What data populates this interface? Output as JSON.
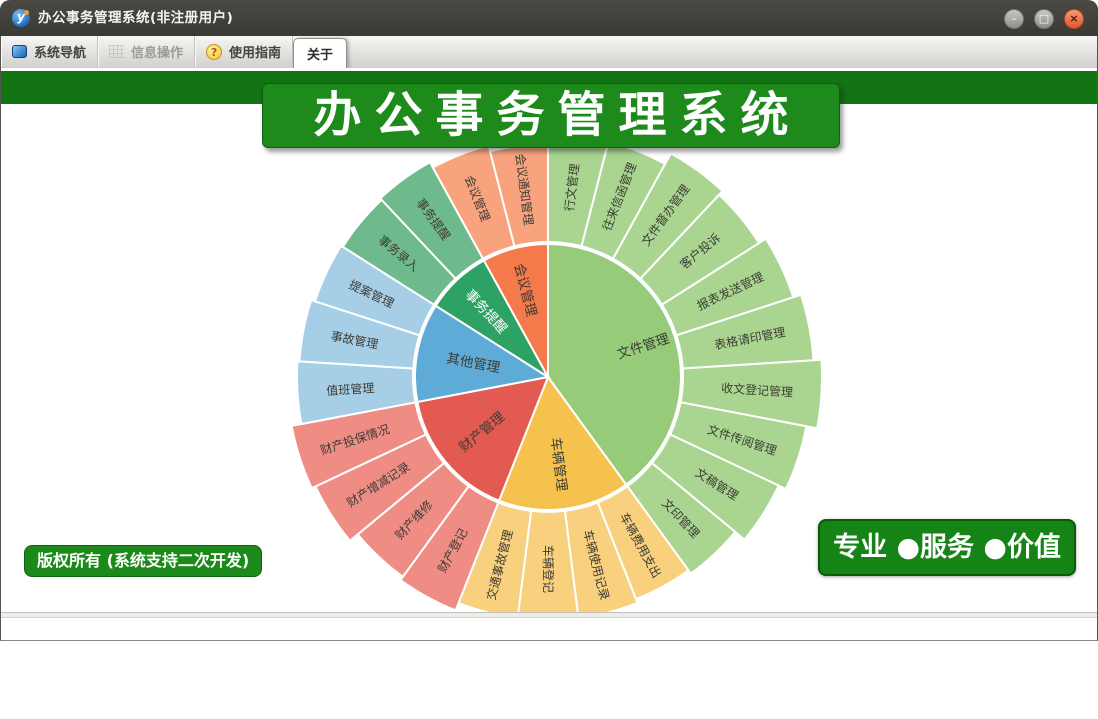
{
  "window": {
    "title": "办公事务管理系统(非注册用户)",
    "app_icon": "y-logo-icon",
    "controls": [
      {
        "name": "minimize-button",
        "glyph": "–"
      },
      {
        "name": "maximize-button",
        "glyph": "□"
      },
      {
        "name": "close-button",
        "glyph": "×"
      }
    ]
  },
  "toolbar": {
    "tabs": [
      {
        "label": "系统导航",
        "icon": "monitor-icon",
        "active": false,
        "enabled": true
      },
      {
        "label": "信息操作",
        "icon": "grid-icon",
        "active": false,
        "enabled": false
      },
      {
        "label": "使用指南",
        "icon": "help-icon",
        "active": false,
        "enabled": true
      },
      {
        "label": "关于",
        "icon": null,
        "active": true,
        "enabled": true
      }
    ]
  },
  "banner": {
    "title": "办公事务管理系统"
  },
  "badges": {
    "copyright": "版权所有 (系统支持二次开发)",
    "slogan": "专业 ●服务 ●价值"
  },
  "colors": {
    "titlebar_bg": "#3e3d39",
    "toolbar_bg": "#e4e3df",
    "banner_band": "#117311",
    "banner_box": "#1e8a1c",
    "badge_green": "#1b8a1b",
    "close_button": "#df5730",
    "label_text": "#3c3c34"
  },
  "chart_data": {
    "type": "sunburst",
    "start_angle_deg": 0,
    "unit_angle_deg": 14.4,
    "inner_radius": 133,
    "legend": "none",
    "groups": [
      {
        "name": "文件管理",
        "color": "#96cb79",
        "child_color": "#aad591",
        "label_color": "#3c3c34",
        "label_radius": 100,
        "children": [
          {
            "name": "行文管理",
            "outer_radius": 237
          },
          {
            "name": "往来信函管理",
            "outer_radius": 243
          },
          {
            "name": "文件督办管理",
            "outer_radius": 255
          },
          {
            "name": "客户投诉",
            "outer_radius": 250
          },
          {
            "name": "报表发送管理",
            "outer_radius": 258
          },
          {
            "name": "表格请印管理",
            "outer_radius": 266
          },
          {
            "name": "收文登记管理",
            "outer_radius": 274
          },
          {
            "name": "文件传阅管理",
            "outer_radius": 263
          },
          {
            "name": "文稿管理",
            "outer_radius": 255
          },
          {
            "name": "文印管理",
            "outer_radius": 243
          }
        ]
      },
      {
        "name": "车辆管理",
        "color": "#f5c24e",
        "child_color": "#f8d07e",
        "label_color": "#3c3c34",
        "label_radius": 88,
        "children": [
          {
            "name": "车辆费用支出",
            "outer_radius": 239
          },
          {
            "name": "车辆使用记录",
            "outer_radius": 243
          },
          {
            "name": "车辆登记",
            "outer_radius": 239
          },
          {
            "name": "交通事故管理",
            "outer_radius": 243
          }
        ]
      },
      {
        "name": "财产管理",
        "color": "#e25a52",
        "child_color": "#ef8d85",
        "label_color": "#3c3c34",
        "label_radius": 86,
        "children": [
          {
            "name": "财产登记",
            "outer_radius": 251
          },
          {
            "name": "财产维修",
            "outer_radius": 247
          },
          {
            "name": "财产增减记录",
            "outer_radius": 257
          },
          {
            "name": "财产投保情况",
            "outer_radius": 261
          }
        ]
      },
      {
        "name": "其他管理",
        "color": "#5fabd8",
        "child_color": "#a6cee7",
        "label_color": "#3c3c34",
        "label_radius": 76,
        "children": [
          {
            "name": "值班管理",
            "outer_radius": 251
          },
          {
            "name": "事故管理",
            "outer_radius": 249
          },
          {
            "name": "提案管理",
            "outer_radius": 245
          }
        ]
      },
      {
        "name": "事务提醒",
        "color": "#2ea165",
        "child_color": "#6fba8c",
        "label_color": "#ffffff",
        "label_radius": 90,
        "children": [
          {
            "name": "事务录入",
            "outer_radius": 243
          },
          {
            "name": "事务提醒",
            "outer_radius": 245
          }
        ]
      },
      {
        "name": "会议管理",
        "color": "#f4794b",
        "child_color": "#f9a37e",
        "label_color": "#3c3c34",
        "label_radius": 90,
        "children": [
          {
            "name": "会议管理",
            "outer_radius": 239
          },
          {
            "name": "会议通知管理",
            "outer_radius": 233
          }
        ]
      }
    ]
  }
}
